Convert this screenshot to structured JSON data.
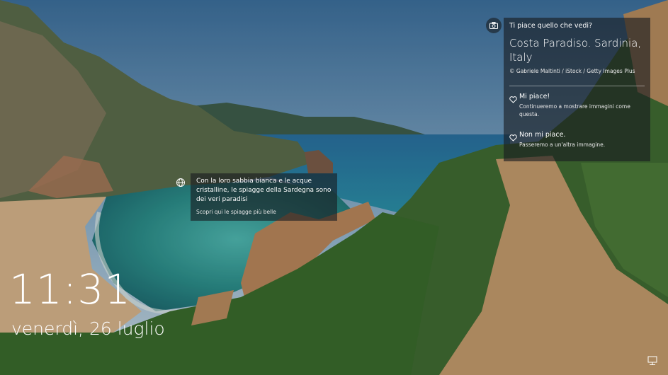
{
  "spotlight": {
    "question": "Ti piace quello che vedi?",
    "location": "Costa Paradiso. Sardinia, Italy",
    "credit": "© Gabriele Maltinti / iStock / Getty Images Plus",
    "like": {
      "title": "Mi piace!",
      "desc": "Continueremo a mostrare immagini come questa."
    },
    "dislike": {
      "title": "Non mi piace.",
      "desc": "Passeremo a un'altra immagine."
    }
  },
  "hotspot": {
    "text": "Con la loro sabbia bianca e le acque cristalline, le spiagge della Sardegna sono dei veri paradisi",
    "link": "Scopri qui le spiagge più belle"
  },
  "clock": {
    "time": "11:31",
    "date": "venerdì, 26 luglio"
  },
  "icons": {
    "camera": "camera-icon",
    "globe": "globe-icon",
    "like": "heart-icon",
    "dislike": "heart-icon",
    "network": "network-icon"
  }
}
